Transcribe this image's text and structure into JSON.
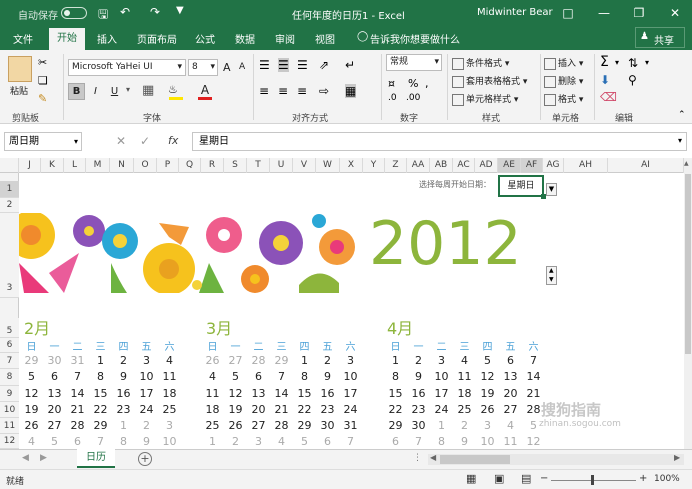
{
  "title_bar": {
    "autosave_label": "自动保存",
    "doc_title": "任何年度的日历1 - Excel",
    "user": "Midwinter Bear"
  },
  "tabs": [
    "文件",
    "开始",
    "插入",
    "页面布局",
    "公式",
    "数据",
    "审阅",
    "视图"
  ],
  "tell_me": "告诉我你想要做什么",
  "share_label": "共享",
  "ribbon": {
    "clipboard": {
      "paste": "粘贴",
      "group": "剪贴板"
    },
    "font": {
      "name": "Microsoft YaHei UI",
      "size": "8",
      "bold": "B",
      "italic": "I",
      "underline": "U",
      "grow": "A",
      "shrink": "A",
      "group": "字体"
    },
    "alignment": {
      "group": "对齐方式"
    },
    "number": {
      "format": "常规",
      "group": "数字"
    },
    "styles": {
      "conditional": "条件格式",
      "table": "套用表格格式",
      "cell": "单元格样式",
      "group": "样式"
    },
    "cells": {
      "insert": "插入",
      "delete": "删除",
      "format": "格式",
      "group": "单元格"
    },
    "editing": {
      "sum": "Σ",
      "group": "编辑"
    }
  },
  "formula_bar": {
    "name_box": "周日期",
    "fx": "fx",
    "content": "星期日"
  },
  "columns": [
    "J",
    "K",
    "L",
    "M",
    "N",
    "O",
    "P",
    "Q",
    "R",
    "S",
    "T",
    "U",
    "V",
    "W",
    "X",
    "Y",
    "Z",
    "AA",
    "AB",
    "AC",
    "AD",
    "AE",
    "AF",
    "AG",
    "AH",
    "AI"
  ],
  "rows": [
    "1",
    "2",
    "3",
    "5",
    "6",
    "7",
    "8",
    "9",
    "10",
    "11",
    "12"
  ],
  "sheet": {
    "start_day_prompt": "选择每周开始日期：",
    "start_day_value": "星期日",
    "year": "2012",
    "months": [
      {
        "name": "2月",
        "weekdays": [
          "日",
          "一",
          "二",
          "三",
          "四",
          "五",
          "六"
        ],
        "days": [
          [
            "29",
            "30",
            "31",
            "1",
            "2",
            "3",
            "4"
          ],
          [
            "5",
            "6",
            "7",
            "8",
            "9",
            "10",
            "11"
          ],
          [
            "12",
            "13",
            "14",
            "15",
            "16",
            "17",
            "18"
          ],
          [
            "19",
            "20",
            "21",
            "22",
            "23",
            "24",
            "25"
          ],
          [
            "26",
            "27",
            "28",
            "29",
            "1",
            "2",
            "3"
          ],
          [
            "4",
            "5",
            "6",
            "7",
            "8",
            "9",
            "10"
          ]
        ]
      },
      {
        "name": "3月",
        "weekdays": [
          "日",
          "一",
          "二",
          "三",
          "四",
          "五",
          "六"
        ],
        "days": [
          [
            "26",
            "27",
            "28",
            "29",
            "1",
            "2",
            "3"
          ],
          [
            "4",
            "5",
            "6",
            "7",
            "8",
            "9",
            "10"
          ],
          [
            "11",
            "12",
            "13",
            "14",
            "15",
            "16",
            "17"
          ],
          [
            "18",
            "19",
            "20",
            "21",
            "22",
            "23",
            "24"
          ],
          [
            "25",
            "26",
            "27",
            "28",
            "29",
            "30",
            "31"
          ],
          [
            "1",
            "2",
            "3",
            "4",
            "5",
            "6",
            "7"
          ]
        ]
      },
      {
        "name": "4月",
        "weekdays": [
          "日",
          "一",
          "二",
          "三",
          "四",
          "五",
          "六"
        ],
        "days": [
          [
            "1",
            "2",
            "3",
            "4",
            "5",
            "6",
            "7"
          ],
          [
            "8",
            "9",
            "10",
            "11",
            "12",
            "13",
            "14"
          ],
          [
            "15",
            "16",
            "17",
            "18",
            "19",
            "20",
            "21"
          ],
          [
            "22",
            "23",
            "24",
            "25",
            "26",
            "27",
            "28"
          ],
          [
            "29",
            "30",
            "1",
            "2",
            "3",
            "4",
            "5"
          ],
          [
            "6",
            "7",
            "8",
            "9",
            "10",
            "11",
            "12"
          ]
        ]
      }
    ]
  },
  "sheet_tab": "日历",
  "status": {
    "ready": "就绪",
    "zoom": "100%"
  },
  "watermark": "搜狗指南",
  "watermark_url": "zhinan.sogou.com",
  "colors": {
    "excel_green": "#217346",
    "accent_green": "#8db53c",
    "weekday_blue": "#4aa0d6"
  }
}
